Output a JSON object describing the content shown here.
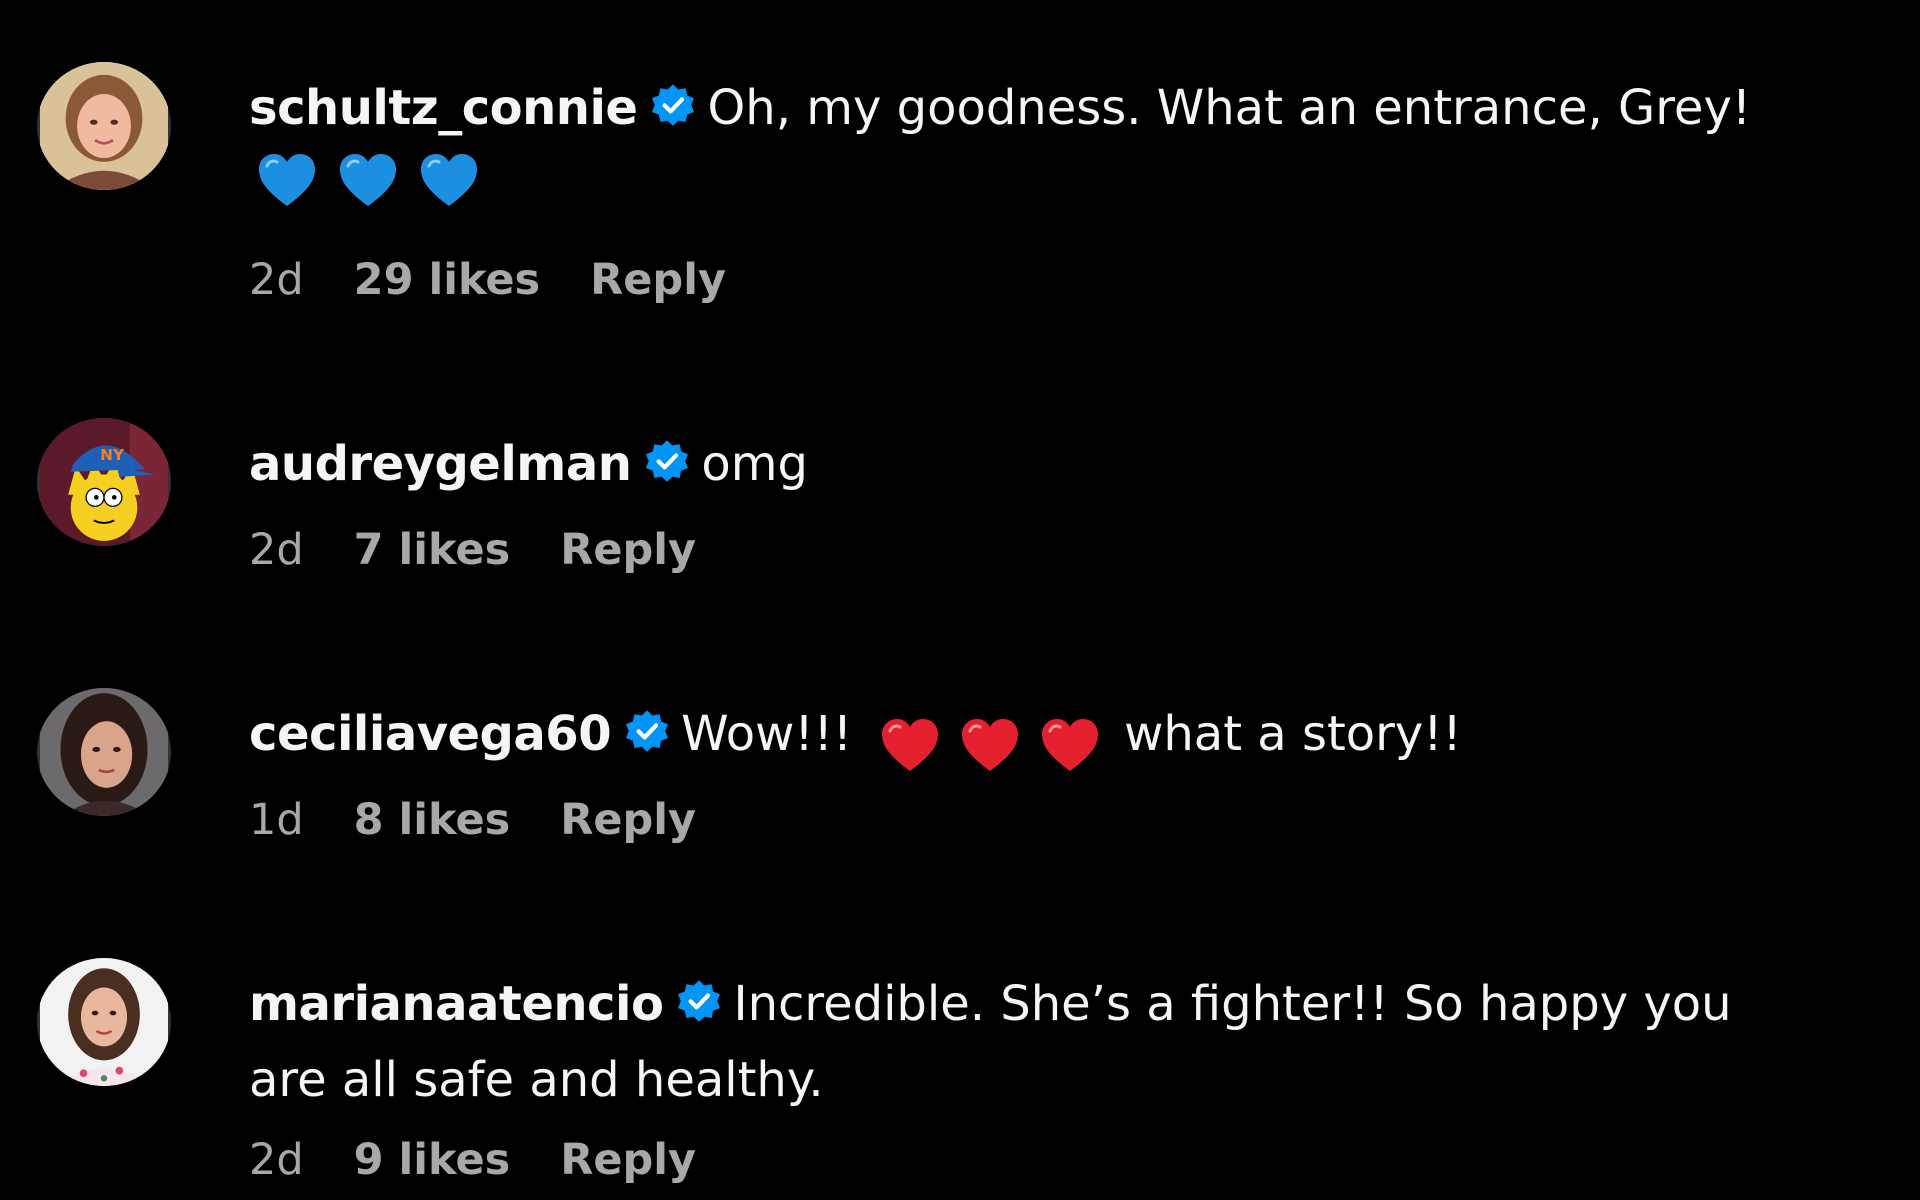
{
  "comments": [
    {
      "username": "schultz_connie",
      "verified": true,
      "text": "Oh, my goodness. What an entrance, Grey!",
      "emoji_line": [
        "blue-heart",
        "blue-heart",
        "blue-heart"
      ],
      "time": "2d",
      "likes": "29 likes",
      "reply_label": "Reply"
    },
    {
      "username": "audreygelman",
      "verified": true,
      "text": "omg",
      "time": "2d",
      "likes": "7 likes",
      "reply_label": "Reply"
    },
    {
      "username": "ceciliavega60",
      "verified": true,
      "text_before": "Wow!!!",
      "inline_emojis": [
        "red-heart",
        "red-heart",
        "red-heart"
      ],
      "text_after": "what a story!!",
      "time": "1d",
      "likes": "8 likes",
      "reply_label": "Reply"
    },
    {
      "username": "marianaatencio",
      "verified": true,
      "text": "Incredible. She’s a fighter!! So happy you",
      "text_cont": "are all safe and healthy.",
      "time": "2d",
      "likes": "9 likes",
      "reply_label": "Reply"
    }
  ],
  "colors": {
    "background": "#000000",
    "primary_text": "#f5f5f5",
    "secondary_text": "#a8a8a8",
    "verified_badge": "#0095f6",
    "blue_heart": "#1d8fe1",
    "red_heart": "#e5202e"
  }
}
